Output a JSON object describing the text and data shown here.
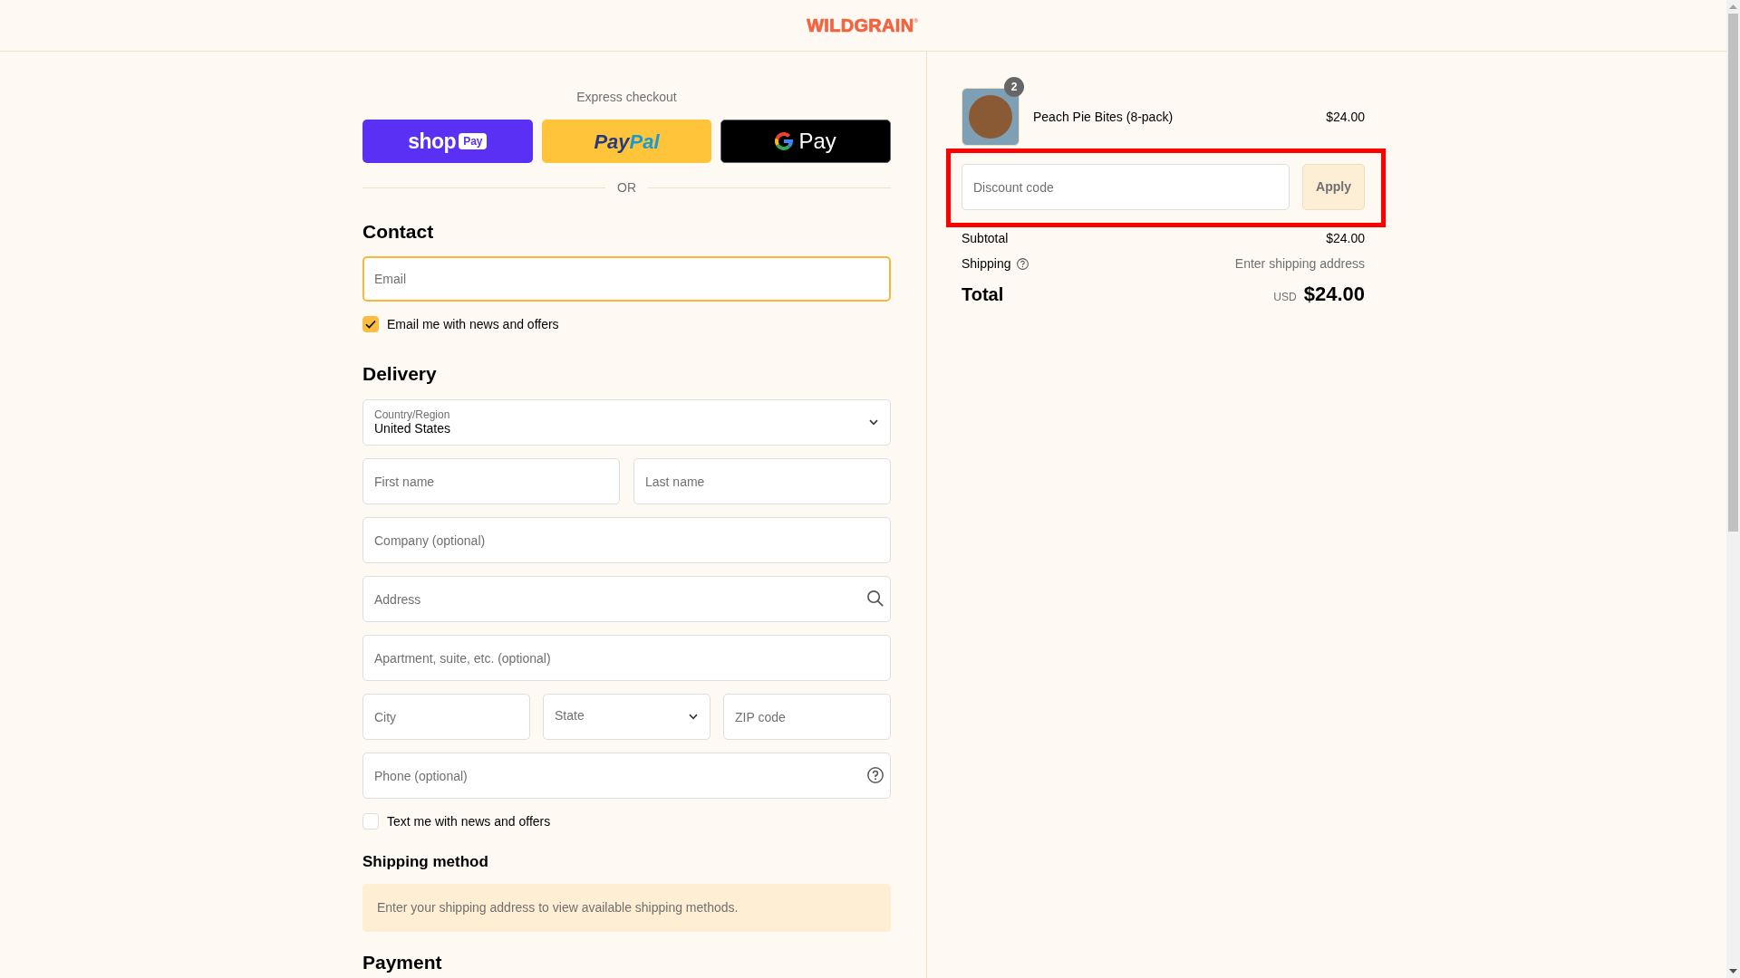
{
  "header": {
    "logo": "WILDGRAIN",
    "logo_mark": "®"
  },
  "express_checkout": {
    "title": "Express checkout",
    "buttons": [
      {
        "kind": "shop_pay",
        "label": "shop",
        "badge": "Pay"
      },
      {
        "kind": "paypal",
        "label_parts": [
          "Pay",
          "Pal"
        ]
      },
      {
        "kind": "google_pay",
        "label": "Pay"
      }
    ],
    "divider": "OR"
  },
  "contact": {
    "heading": "Contact",
    "email": {
      "placeholder": "Email",
      "focused": true
    },
    "newsletter": {
      "label": "Email me with news and offers",
      "checked": true
    }
  },
  "delivery": {
    "heading": "Delivery",
    "rows": [
      [
        {
          "kind": "select",
          "label": "Country/Region",
          "value": "United States"
        }
      ],
      [
        {
          "kind": "text",
          "placeholder": "First name"
        },
        {
          "kind": "text",
          "placeholder": "Last name"
        }
      ],
      [
        {
          "kind": "text",
          "placeholder": "Company (optional)"
        }
      ],
      [
        {
          "kind": "address",
          "placeholder": "Address"
        }
      ],
      [
        {
          "kind": "text",
          "placeholder": "Apartment, suite, etc. (optional)"
        }
      ],
      [
        {
          "kind": "text",
          "placeholder": "City"
        },
        {
          "kind": "select",
          "placeholder": "State"
        },
        {
          "kind": "text",
          "placeholder": "ZIP code"
        }
      ],
      [
        {
          "kind": "phone",
          "placeholder": "Phone (optional)"
        }
      ]
    ],
    "sms": {
      "label": "Text me with news and offers",
      "checked": false
    }
  },
  "shipping_method": {
    "heading": "Shipping method",
    "notice": "Enter your shipping address to view available shipping methods."
  },
  "payment": {
    "heading": "Payment"
  },
  "order_summary": {
    "items": [
      {
        "name": "Peach Pie Bites (8-pack)",
        "quantity": "2",
        "price": "$24.00"
      }
    ],
    "discount": {
      "placeholder": "Discount code",
      "button": "Apply",
      "disabled": true,
      "outlined": true
    },
    "subtotal": {
      "label": "Subtotal",
      "value": "$24.00"
    },
    "shipping": {
      "label": "Shipping",
      "value": "Enter shipping address"
    },
    "total": {
      "label": "Total",
      "currency": "USD",
      "value": "$24.00"
    }
  }
}
